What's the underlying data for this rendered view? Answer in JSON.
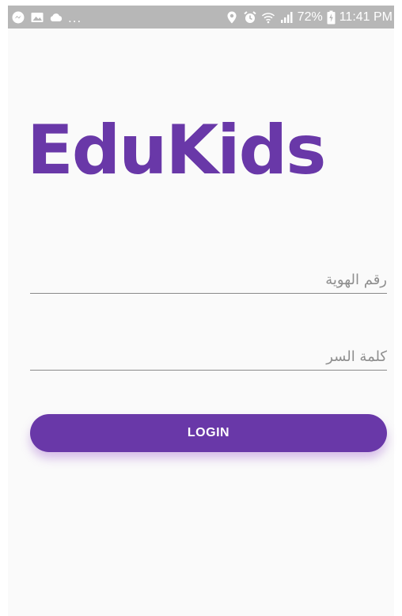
{
  "status_bar": {
    "left_icons": [
      "messenger-icon",
      "gallery-icon",
      "cloud-icon"
    ],
    "more_dots": "...",
    "right_icons": [
      "location-icon",
      "alarm-icon",
      "wifi-icon",
      "signal-icon"
    ],
    "battery_percent": "72%",
    "battery_icon": "battery-charging-icon",
    "time": "11:41 PM",
    "background_color": "#b7b7b7"
  },
  "app": {
    "logo_text": "EduKids",
    "brand_color": "#6938a8"
  },
  "login_form": {
    "id_field": {
      "placeholder": "رقم الهوية",
      "value": ""
    },
    "password_field": {
      "placeholder": "كلمة السر",
      "value": ""
    },
    "login_button_label": "LOGIN"
  }
}
